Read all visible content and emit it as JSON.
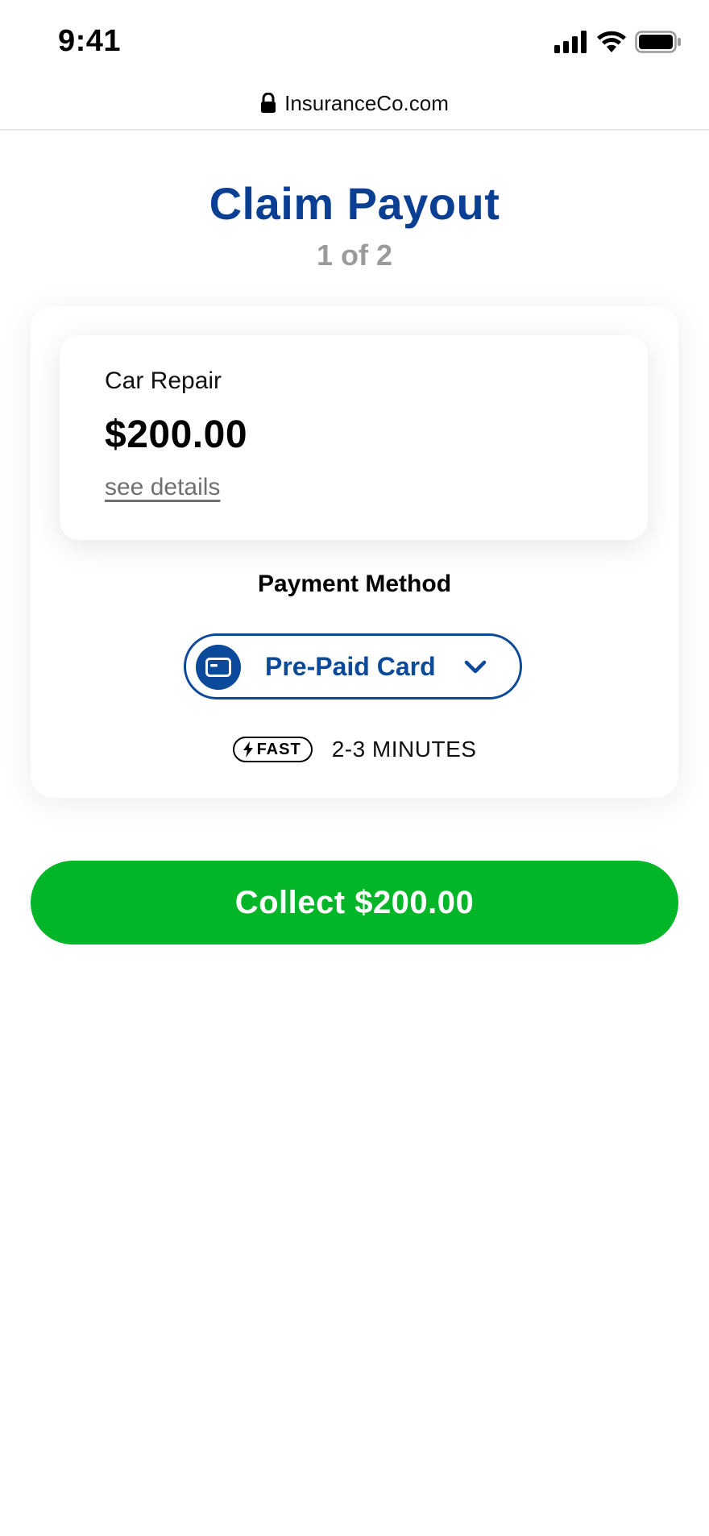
{
  "status_bar": {
    "time": "9:41"
  },
  "browser": {
    "url": "InsuranceCo.com"
  },
  "header": {
    "title": "Claim Payout",
    "step": "1 of 2"
  },
  "claim": {
    "label": "Car Repair",
    "amount": "$200.00",
    "details_link": "see details"
  },
  "payment": {
    "heading": "Payment Method",
    "selected_method": "Pre-Paid Card",
    "speed_badge": "FAST",
    "speed_text": "2-3 MINUTES"
  },
  "actions": {
    "collect_label": "Collect $200.00"
  },
  "colors": {
    "brand_blue": "#0b3f94",
    "select_blue": "#0b4a9a",
    "collect_green": "#02b628",
    "muted_gray": "#9b9b9b"
  },
  "icons": {
    "lock": "lock-icon",
    "signal": "cellular-signal-icon",
    "wifi": "wifi-icon",
    "battery": "battery-icon",
    "card": "card-icon",
    "chevron": "chevron-down-icon",
    "bolt": "lightning-bolt-icon"
  }
}
